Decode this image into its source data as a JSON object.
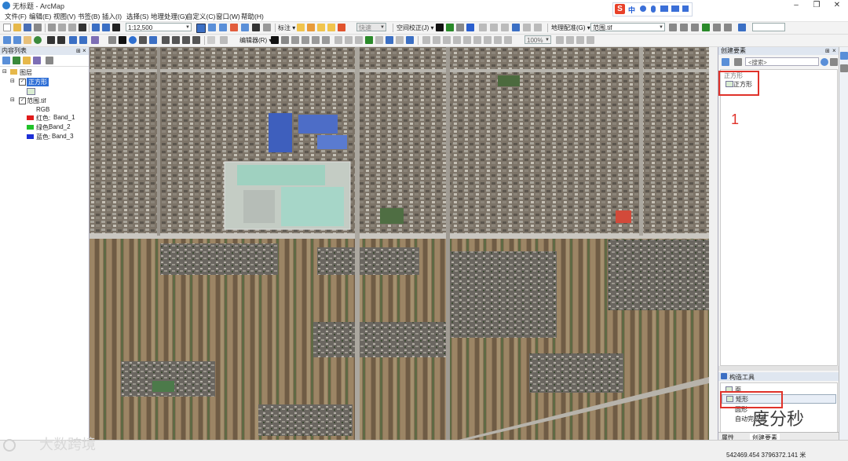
{
  "window": {
    "title": "无标题 - ArcMap",
    "controls": [
      "–",
      "❐",
      "✕"
    ]
  },
  "menus": [
    "文件(F)",
    "编辑(E)",
    "视图(V)",
    "书签(B)",
    "插入(I)",
    "选择(S)",
    "地理处理(G)",
    "自定义(C)",
    "窗口(W)",
    "帮助(H)"
  ],
  "toolbar": {
    "scale_value": "1:12,500",
    "editor_label": "标注 ▾",
    "fast_label": "快速",
    "spatial_adjust_label": "空间校正(J) ▾",
    "georef_label": "地理配准(G) ▾",
    "georef_layer": "范围.tif",
    "editor_menu_label": "编辑器(R) ▾",
    "zoom_percent": "100%"
  },
  "ime": {
    "logo": "S",
    "mode": "中"
  },
  "toc": {
    "title": "内容列表",
    "layers_root": "图层",
    "layer_square": "正方形",
    "layer_tif": "范围.tif",
    "rgb_label": "RGB",
    "bands": [
      {
        "channel": "红色:",
        "band": "Band_1",
        "color": "#e01b1b"
      },
      {
        "channel": "绿色:",
        "band": "Band_2",
        "color": "#22c22a"
      },
      {
        "channel": "蓝色:",
        "band": "Band_3",
        "color": "#1d2fd6"
      }
    ]
  },
  "create_features": {
    "title": "创建要素",
    "search_placeholder": "<搜索>",
    "group_label": "正方形",
    "template_label": "正方形",
    "annotation_1": "1",
    "construct_tools_title": "构造工具",
    "tools": [
      "面",
      "矩形",
      "圆形",
      "自动完成面"
    ],
    "tabs": [
      "属性",
      "创建要素"
    ]
  },
  "status": {
    "coords": "542469.454  3796372.141 米"
  },
  "watermarks": {
    "left": "大数跨境",
    "right": "度分秒"
  }
}
